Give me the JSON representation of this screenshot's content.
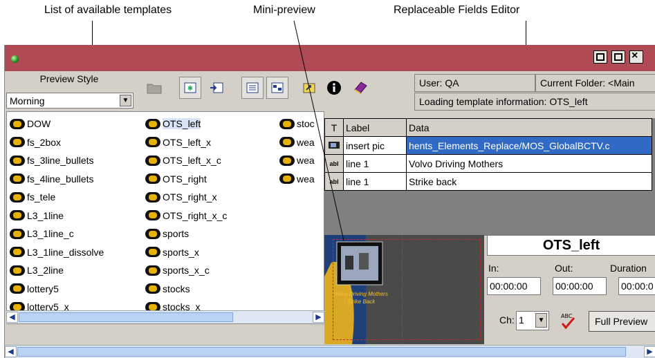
{
  "callouts": {
    "templates": "List of available templates",
    "preview": "Mini-preview",
    "fields": "Replaceable Fields Editor"
  },
  "window": {
    "close_glyph": "×"
  },
  "preview_style": {
    "label": "Preview Style",
    "selected": "Morning"
  },
  "toolbar": {
    "icons": [
      "folder-icon",
      "new-template-icon",
      "import-icon",
      "list-view-icon",
      "detail-view-icon",
      "export-icon",
      "info-icon",
      "help-book-icon"
    ]
  },
  "templates": {
    "col1": [
      "DOW",
      "fs_2box",
      "fs_3line_bullets",
      "fs_4line_bullets",
      "fs_tele",
      "L3_1line",
      "L3_1line_c",
      "L3_1line_dissolve",
      "L3_2line",
      "lottery5",
      "lottery5_x"
    ],
    "col2": [
      "OTS_left",
      "OTS_left_x",
      "OTS_left_x_c",
      "OTS_right",
      "OTS_right_x",
      "OTS_right_x_c",
      "sports",
      "sports_x",
      "sports_x_c",
      "stocks",
      "stocks_x"
    ],
    "col3": [
      "stoc",
      "wea",
      "wea",
      "wea"
    ],
    "selected": "OTS_left"
  },
  "status": {
    "user": "User: QA",
    "folder": "Current Folder: <Main",
    "message": "Loading template information: OTS_left"
  },
  "fields": {
    "headers": {
      "type": "T",
      "label": "Label",
      "data": "Data"
    },
    "rows": [
      {
        "icon": "picture-icon",
        "label": "insert pic",
        "data": "hents_Elements_Replace/MOS_GlobalBCTV.c"
      },
      {
        "icon": "text-field-icon",
        "type_text": "abl",
        "label": "line 1",
        "data": "Volvo Driving Mothers"
      },
      {
        "icon": "text-field-icon",
        "type_text": "abl",
        "label": "line 1",
        "data": "Strike back"
      }
    ]
  },
  "mini_preview": {
    "caption_line1": "Volvo Driving Mothers",
    "caption_line2": "Strike Back"
  },
  "timing": {
    "template_name": "OTS_left",
    "in_label": "In:",
    "out_label": "Out:",
    "duration_label": "Duration",
    "in_value": "00:00:00",
    "out_value": "00:00:00",
    "duration_value": "00:00:0",
    "channel_label": "Ch:",
    "channel_value": "1",
    "full_preview": "Full Preview"
  }
}
